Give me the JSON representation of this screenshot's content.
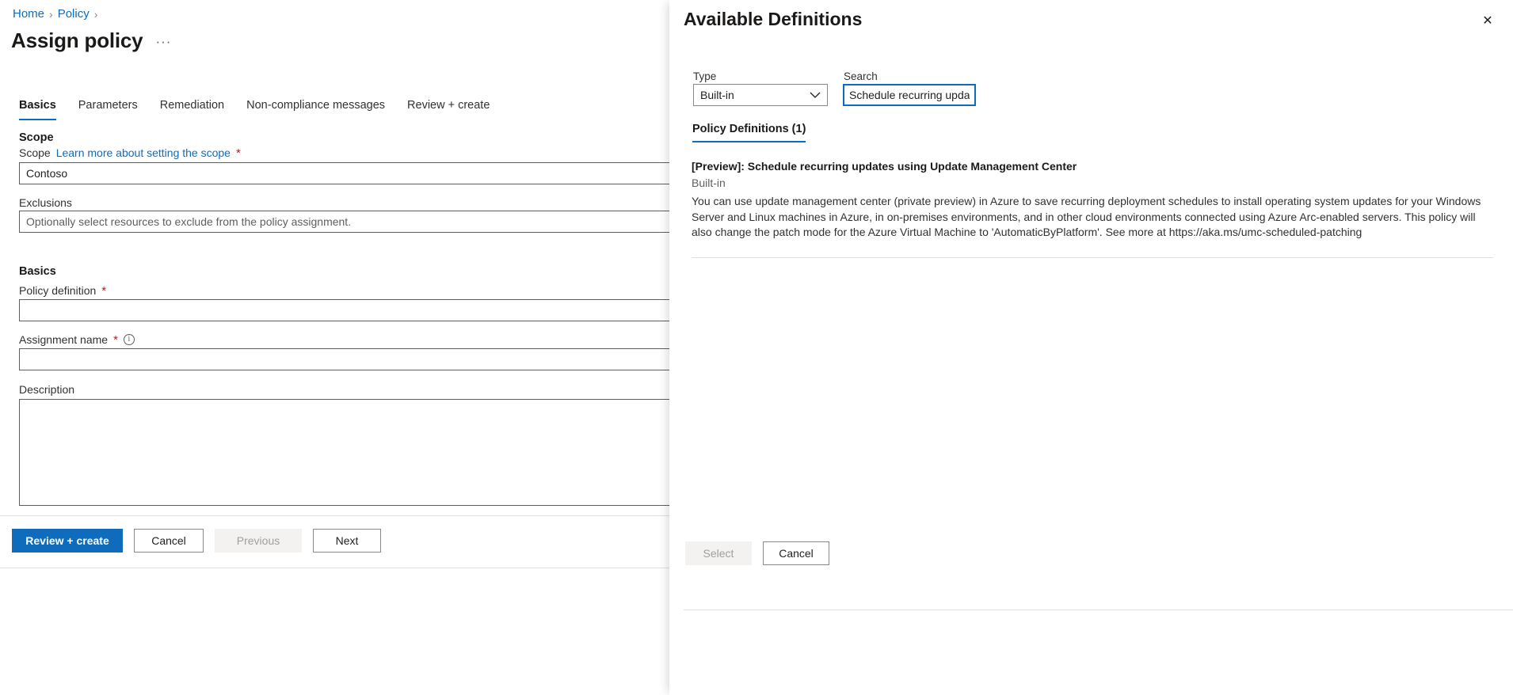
{
  "breadcrumb": {
    "items": [
      {
        "label": "Home"
      },
      {
        "label": "Policy"
      }
    ],
    "separator": "›"
  },
  "page": {
    "title": "Assign policy",
    "overflow_label": "···"
  },
  "tabs": [
    {
      "label": "Basics",
      "active": true
    },
    {
      "label": "Parameters",
      "active": false
    },
    {
      "label": "Remediation",
      "active": false
    },
    {
      "label": "Non-compliance messages",
      "active": false
    },
    {
      "label": "Review + create",
      "active": false
    }
  ],
  "form": {
    "scope_section_heading": "Scope",
    "scope_label": "Scope",
    "scope_link": "Learn more about setting the scope",
    "scope_required": "*",
    "scope_value": "Contoso",
    "exclusions_label": "Exclusions",
    "exclusions_placeholder": "Optionally select resources to exclude from the policy assignment.",
    "exclusions_value": "",
    "basics_section_heading": "Basics",
    "policy_definition_label": "Policy definition",
    "policy_definition_required": "*",
    "policy_definition_value": "",
    "assignment_name_label": "Assignment name",
    "assignment_name_required": "*",
    "assignment_name_info": "i",
    "assignment_name_value": "",
    "description_label": "Description",
    "description_value": ""
  },
  "footer": {
    "review_create": "Review + create",
    "cancel": "Cancel",
    "previous": "Previous",
    "next": "Next"
  },
  "panel": {
    "title": "Available Definitions",
    "close_icon": "✕",
    "type_label": "Type",
    "type_value": "Built-in",
    "type_caret": "⌄",
    "search_label": "Search",
    "search_value": "Schedule recurring updat",
    "results_tab": "Policy Definitions (1)",
    "results": [
      {
        "title": "[Preview]: Schedule recurring updates using Update Management Center",
        "source": "Built-in",
        "description": "You can use update management center (private preview) in Azure to save recurring deployment schedules to install operating system updates for your Windows Server and Linux machines in Azure, in on-premises environments, and in other cloud environments connected using Azure Arc-enabled servers. This policy will also change the patch mode for the Azure Virtual Machine to 'AutomaticByPlatform'. See more at https://aka.ms/umc-scheduled-patching"
      }
    ],
    "select_button": "Select",
    "cancel_button": "Cancel"
  },
  "colors": {
    "accent": "#0f6cbd",
    "link": "#0f6cbd",
    "required": "#a4262c",
    "border": "#605e5c",
    "divider": "#e1dfdd",
    "disabled_bg": "#f3f2f1",
    "disabled_text": "#a19f9d"
  }
}
